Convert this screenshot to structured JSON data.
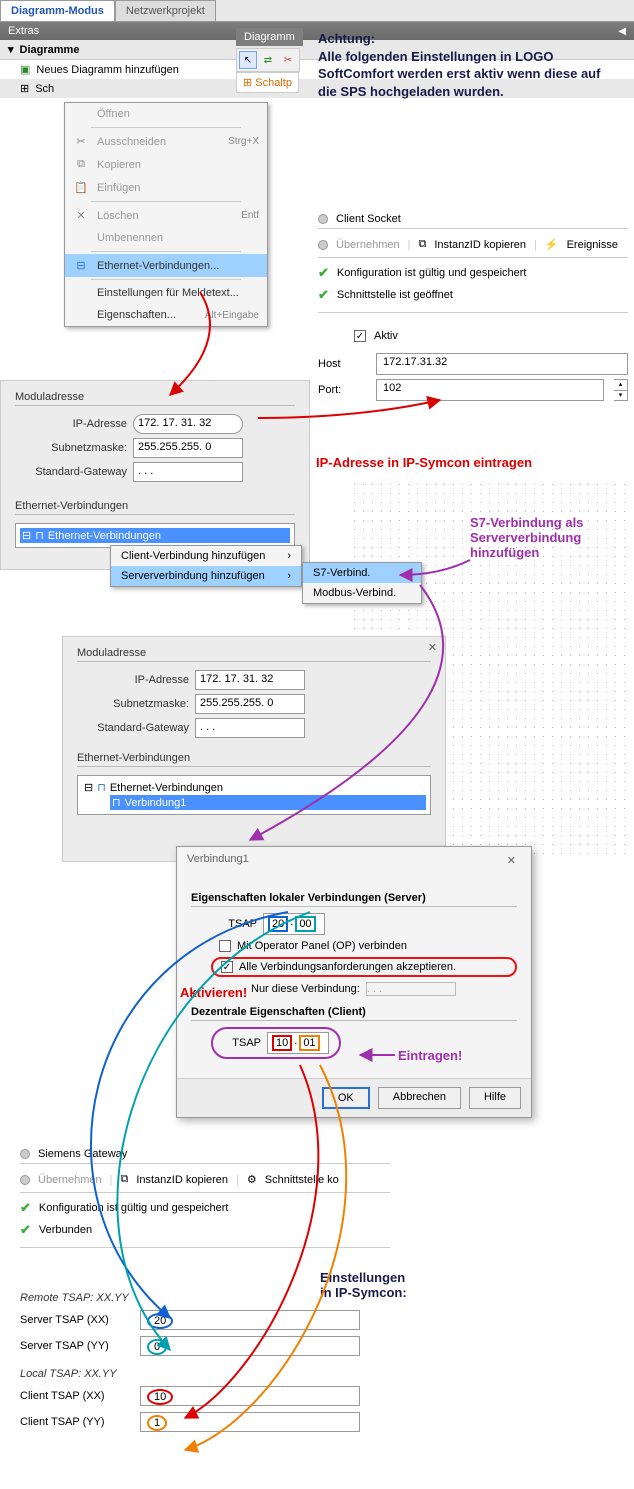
{
  "tabs": {
    "diagram": "Diagramm-Modus",
    "network": "Netzwerkprojekt"
  },
  "extras": "Extras",
  "diagramme": "Diagramme",
  "new_diagram": "Neues Diagramm hinzufügen",
  "sch": "Sch",
  "schaltp": "Schaltp",
  "diagramm_tab": "Diagramm",
  "ctx": {
    "open": "Öffnen",
    "cut": "Ausschneiden",
    "cut_sc": "Strg+X",
    "copy": "Kopieren",
    "paste": "Einfügen",
    "delete": "Löschen",
    "delete_sc": "Entf",
    "rename": "Umbenennen",
    "ethernet": "Ethernet-Verbindungen...",
    "meldetext": "Einstellungen für Meldetext...",
    "props": "Eigenschaften...",
    "props_sc": "Alt+Eingabe"
  },
  "note": "Achtung:\nAlle folgenden Einstellungen in LOGO SoftComfort werden erst aktiv wenn diese auf die SPS hochgeladen wurden.",
  "client_socket": {
    "title": "Client Socket",
    "apply": "Übernehmen",
    "copyid": "InstanzID kopieren",
    "events": "Ereignisse",
    "s1": "Konfiguration ist gültig und gespeichert",
    "s2": "Schnittstelle ist geöffnet",
    "active": "Aktiv",
    "host": "Host",
    "host_v": "172.17.31.32",
    "port": "Port:",
    "port_v": "102"
  },
  "mod1": {
    "title": "Moduladresse",
    "ip": "IP-Adresse",
    "ip_v": "172. 17. 31. 32",
    "mask": "Subnetzmaske:",
    "mask_v": "255.255.255.  0",
    "gw": "Standard-Gateway",
    "gw_v": ".    .    .",
    "eth_title": "Ethernet-Verbindungen",
    "eth_node": "Ethernet-Verbindungen"
  },
  "annot_ip": "IP-Adresse in IP-Symcon eintragen",
  "annot_s7": "S7-Verbindung als Serververbindung hinzufügen",
  "subctx": {
    "client": "Client-Verbindung hinzufügen",
    "server": "Serververbindung hinzufügen",
    "s7": "S7-Verbind.",
    "modbus": "Modbus-Verbind."
  },
  "mod2": {
    "verbindung": "Verbindung1"
  },
  "dlg": {
    "title": "Verbindung1",
    "grp1": "Eigenschaften lokaler Verbindungen (Server)",
    "tsap": "TSAP",
    "tsap1a": "20",
    "tsap1b": "00",
    "op": "Mit Operator Panel (OP) verbinden",
    "accept": "Alle Verbindungsanforderungen akzeptieren.",
    "only": "Nur diese Verbindung:",
    "only_v": ".    .    .",
    "grp2": "Dezentrale Eigenschaften (Client)",
    "tsap2a": "10",
    "tsap2b": "01",
    "ok": "OK",
    "cancel": "Abbrechen",
    "help": "Hilfe"
  },
  "annot_activate": "Aktivieren!",
  "annot_enter": "Eintragen!",
  "siemens": {
    "title": "Siemens Gateway",
    "apply": "Übernehmen",
    "copyid": "InstanzID kopieren",
    "iface": "Schnittstelle ko",
    "s1": "Konfiguration ist gültig und gespeichert",
    "s2": "Verbunden"
  },
  "annot_ipsym": "Einstellungen\nin IP-Symcon:",
  "tsap_form": {
    "remote": "Remote TSAP: XX.YY",
    "sxx": "Server TSAP (XX)",
    "sxx_v": "20",
    "syy": "Server TSAP (YY)",
    "syy_v": "0",
    "local": "Local TSAP: XX.YY",
    "cxx": "Client TSAP (XX)",
    "cxx_v": "10",
    "cyy": "Client TSAP (YY)",
    "cyy_v": "1"
  }
}
